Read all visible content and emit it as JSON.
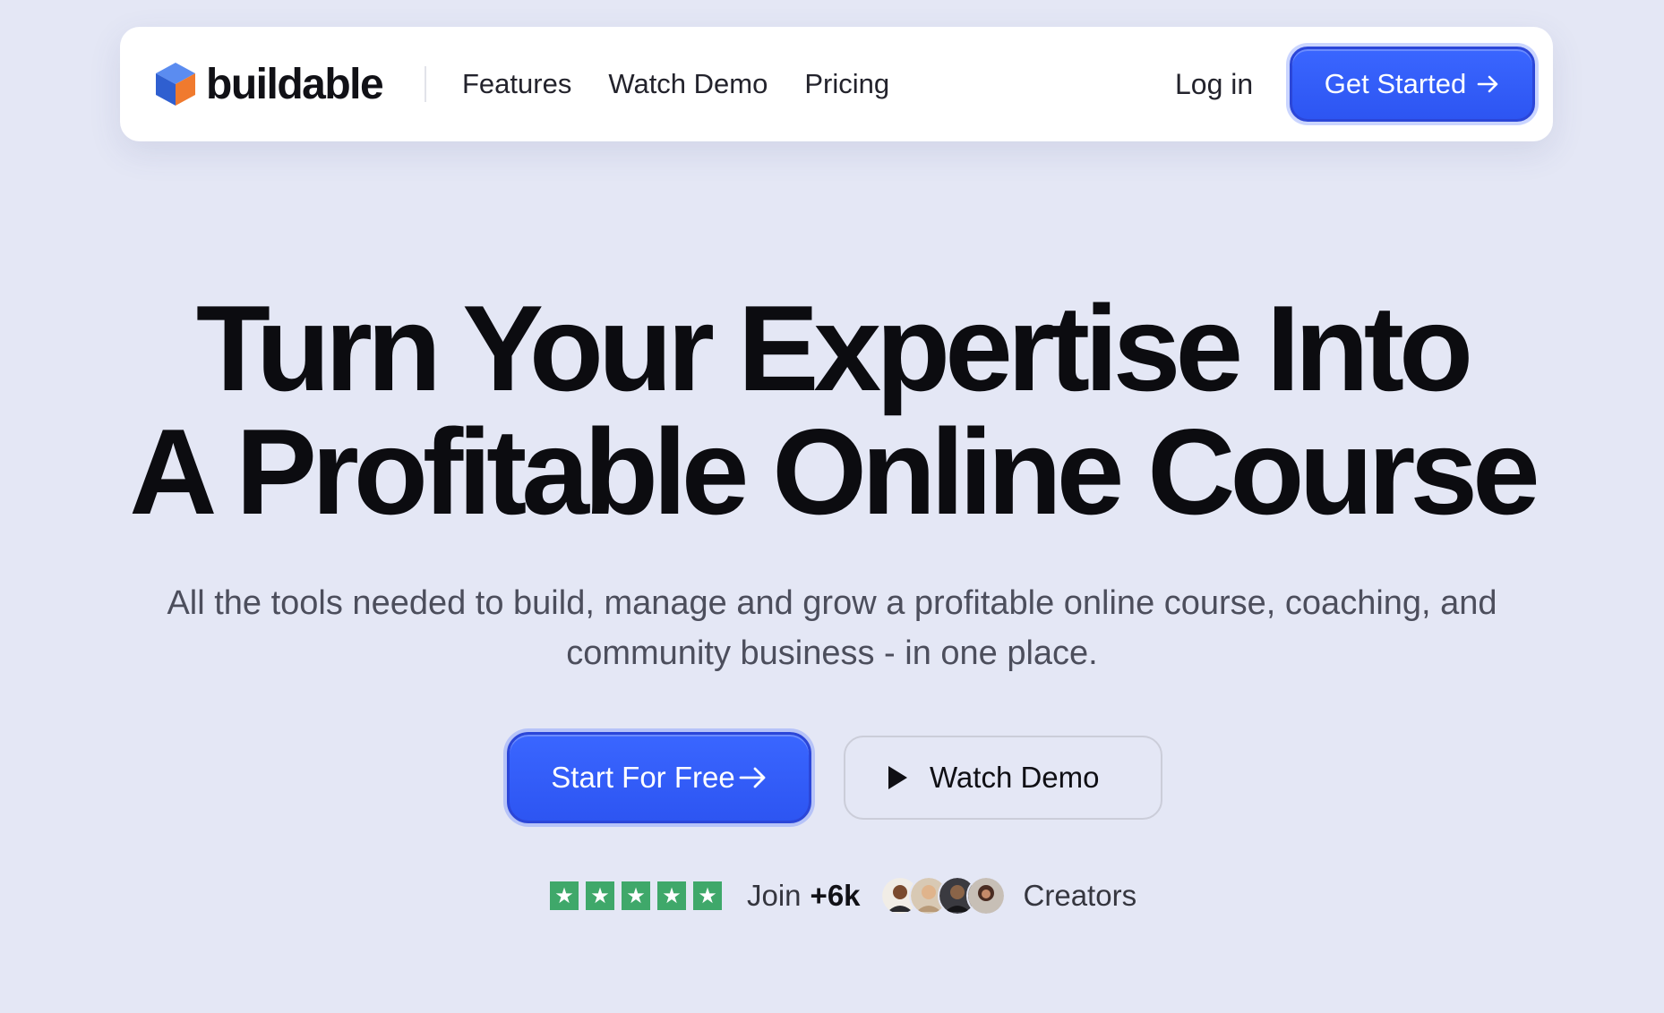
{
  "brand": {
    "name": "buildable",
    "logo_icon": "cube-icon",
    "colors": {
      "cube_blue": "#3b6fe0",
      "cube_orange": "#f07a2e"
    }
  },
  "nav": {
    "links": [
      "Features",
      "Watch Demo",
      "Pricing"
    ],
    "login_label": "Log in",
    "cta_label": "Get Started",
    "cta_icon": "arrow-right-icon"
  },
  "hero": {
    "title_line1": "Turn Your Expertise Into",
    "title_line2": "A Profitable Online Course",
    "subtitle_line1": "All the tools needed to build, manage and grow a profitable online course, coaching, and",
    "subtitle_line2": "community business - in one place."
  },
  "cta": {
    "primary_label": "Start For Free",
    "primary_icon": "arrow-right-icon",
    "secondary_label": "Watch Demo",
    "secondary_icon": "play-icon"
  },
  "social_proof": {
    "rating_stars": 5,
    "star_color": "#3fa86a",
    "join_prefix": "Join",
    "join_count": "+6k",
    "avatar_count": 4,
    "suffix": "Creators"
  },
  "colors": {
    "accent": "#3560fb",
    "background": "#e4e7f5"
  }
}
